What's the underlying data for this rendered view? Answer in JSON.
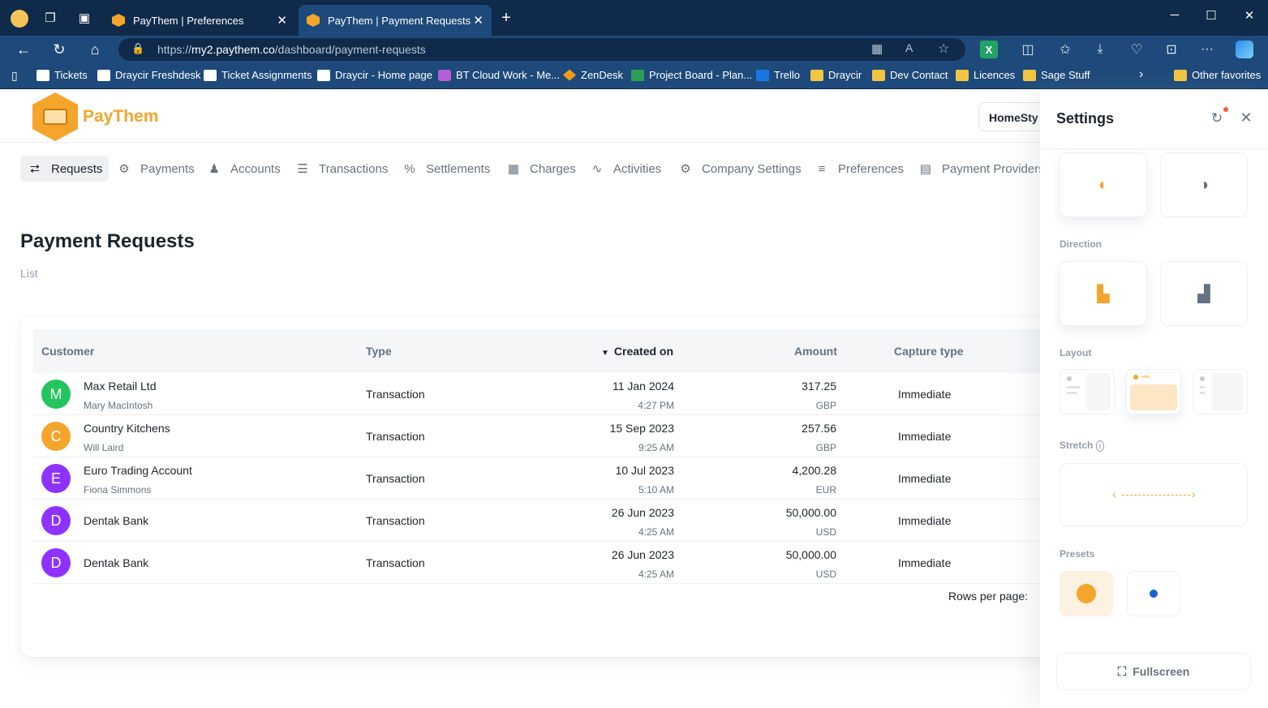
{
  "browser": {
    "tabs": [
      {
        "title": "PayThem | Preferences",
        "active": false
      },
      {
        "title": "PayThem | Payment Requests",
        "active": true
      }
    ],
    "url_prefix": "https://",
    "url_domain": "my2.paythem.co",
    "url_path": "/dashboard/payment-requests",
    "favorites": [
      {
        "label": "Tickets",
        "icon": "page-icon"
      },
      {
        "label": "Draycir Freshdesk",
        "icon": "page-icon"
      },
      {
        "label": "Ticket Assignments",
        "icon": "page-icon"
      },
      {
        "label": "Draycir - Home page",
        "icon": "page-icon"
      },
      {
        "label": "BT Cloud Work - Me...",
        "icon": "bt-icon"
      },
      {
        "label": "ZenDesk",
        "icon": "zendesk-icon"
      },
      {
        "label": "Project Board - Plan...",
        "icon": "planner-icon"
      },
      {
        "label": "Trello",
        "icon": "trello-icon"
      },
      {
        "label": "Draycir",
        "icon": "folder-icon"
      },
      {
        "label": "Dev Contact",
        "icon": "folder-icon"
      },
      {
        "label": "Licences",
        "icon": "folder-icon"
      },
      {
        "label": "Sage Stuff",
        "icon": "folder-icon"
      }
    ],
    "other_favorites": "Other favorites",
    "chevron": "›"
  },
  "app": {
    "logo_text": "PayThem",
    "company_selector": "HomeSty",
    "nav": [
      {
        "label": "Requests",
        "icon": "request-icon",
        "glyph": "⮂",
        "active": true
      },
      {
        "label": "Payments",
        "icon": "payments-icon",
        "glyph": "⚙",
        "active": false
      },
      {
        "label": "Accounts",
        "icon": "accounts-icon",
        "glyph": "♟",
        "active": false
      },
      {
        "label": "Transactions",
        "icon": "transactions-icon",
        "glyph": "☰",
        "active": false
      },
      {
        "label": "Settlements",
        "icon": "percent-icon",
        "glyph": "%",
        "active": false
      },
      {
        "label": "Charges",
        "icon": "calculator-icon",
        "glyph": "▦",
        "active": false
      },
      {
        "label": "Activities",
        "icon": "activity-icon",
        "glyph": "∿",
        "active": false
      },
      {
        "label": "Company Settings",
        "icon": "gear-icon",
        "glyph": "⚙",
        "active": false
      },
      {
        "label": "Preferences",
        "icon": "sliders-icon",
        "glyph": "≡",
        "active": false
      },
      {
        "label": "Payment Providers",
        "icon": "provider-icon",
        "glyph": "▤",
        "active": false
      }
    ],
    "page_title": "Payment Requests",
    "page_subtitle": "List",
    "table": {
      "headers": [
        "Customer",
        "Type",
        "Created on",
        "Amount",
        "Capture type"
      ],
      "sort_glyph": "▼",
      "rows": [
        {
          "initial": "M",
          "color": "#22c55e",
          "name": "Max Retail Ltd",
          "contact": "Mary MacIntosh",
          "type": "Transaction",
          "date": "11 Jan 2024",
          "time": "4:27 PM",
          "amount": "317.25",
          "currency": "GBP",
          "capture": "Immediate"
        },
        {
          "initial": "C",
          "color": "#f4a52b",
          "name": "Country Kitchens",
          "contact": "Will Laird",
          "type": "Transaction",
          "date": "15 Sep 2023",
          "time": "9:25 AM",
          "amount": "257.56",
          "currency": "GBP",
          "capture": "Immediate"
        },
        {
          "initial": "E",
          "color": "#8e33ff",
          "name": "Euro Trading Account",
          "contact": "Fiona Simmons",
          "type": "Transaction",
          "date": "10 Jul 2023",
          "time": "5:10 AM",
          "amount": "4,200.28",
          "currency": "EUR",
          "capture": "Immediate"
        },
        {
          "initial": "D",
          "color": "#8e33ff",
          "name": "Dentak Bank",
          "contact": "",
          "type": "Transaction",
          "date": "26 Jun 2023",
          "time": "4:25 AM",
          "amount": "50,000.00",
          "currency": "USD",
          "capture": "Immediate"
        },
        {
          "initial": "D",
          "color": "#8e33ff",
          "name": "Dentak Bank",
          "contact": "",
          "type": "Transaction",
          "date": "26 Jun 2023",
          "time": "4:25 AM",
          "amount": "50,000.00",
          "currency": "USD",
          "capture": "Immediate"
        }
      ],
      "rows_per_page_label": "Rows per page:"
    }
  },
  "settings": {
    "title": "Settings",
    "direction_label": "Direction",
    "layout_label": "Layout",
    "stretch_label": "Stretch",
    "presets_label": "Presets",
    "fullscreen_label": "Fullscreen",
    "arrows": {
      "left": "‹",
      "right": "›"
    },
    "colors": {
      "accent": "#f4a52b",
      "blue": "#1b5fd8"
    }
  }
}
